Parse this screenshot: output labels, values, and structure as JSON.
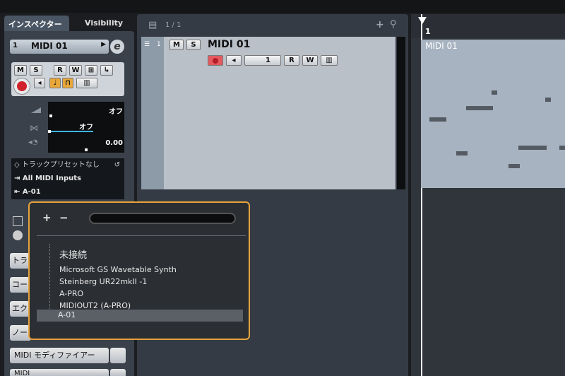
{
  "inspector": {
    "tabs": [
      "インスペクター",
      "Visibility"
    ],
    "track": {
      "number": "1",
      "name": "MIDI 01",
      "edit_glyph": "e"
    },
    "buttons": {
      "m": "M",
      "s": "S",
      "r": "R",
      "w": "W"
    },
    "volume_value": "オフ",
    "pan_value": "オフ",
    "delay_value": "0.00",
    "preset": "トラックプリセットなし",
    "input": "All MIDI Inputs",
    "output": "A-01",
    "side_buttons": [
      "トラ",
      "コー",
      "エク",
      "ノー"
    ],
    "midi_modifier": "MIDI モディファイアー",
    "partial_label": "MIDI"
  },
  "tracklist": {
    "counter": "1 / 1",
    "track": {
      "number": "1",
      "name": "MIDI 01",
      "m": "M",
      "s": "S",
      "channel": "1",
      "r": "R",
      "w": "W"
    }
  },
  "arrange": {
    "ruler_bar": "1",
    "part_name": "MIDI 01"
  },
  "popup": {
    "plus": "+",
    "minus": "−",
    "search_value": "",
    "items": [
      "未接続",
      "Microsoft GS Wavetable Synth",
      "Steinberg UR22mkII -1",
      "A-PRO",
      "MIDIOUT2 (A-PRO)",
      "A-01"
    ],
    "selected_index": 5,
    "border_color": "#e6a43b"
  },
  "colors": {
    "record": "#d0222b",
    "monitor_active": "#e8a73a"
  }
}
